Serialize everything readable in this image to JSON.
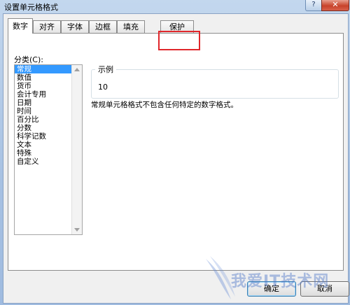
{
  "window": {
    "title": "设置单元格格式",
    "help_label": "?",
    "close_label": "✕"
  },
  "tabs": [
    {
      "label": "数字",
      "active": true
    },
    {
      "label": "对齐"
    },
    {
      "label": "字体"
    },
    {
      "label": "边框"
    },
    {
      "label": "填充"
    },
    {
      "label": "保护"
    }
  ],
  "category": {
    "label": "分类(C):",
    "items": [
      "常规",
      "数值",
      "货币",
      "会计专用",
      "日期",
      "时间",
      "百分比",
      "分数",
      "科学记数",
      "文本",
      "特殊",
      "自定义"
    ],
    "selected_index": 0
  },
  "sample": {
    "title": "示例",
    "value": "10"
  },
  "description": "常规单元格格式不包含任何特定的数字格式。",
  "buttons": {
    "ok": "确定",
    "cancel": "取消"
  },
  "watermark": "我爱IT技术网",
  "colors": {
    "highlight": "#e0272b",
    "selection": "#3399ff"
  }
}
